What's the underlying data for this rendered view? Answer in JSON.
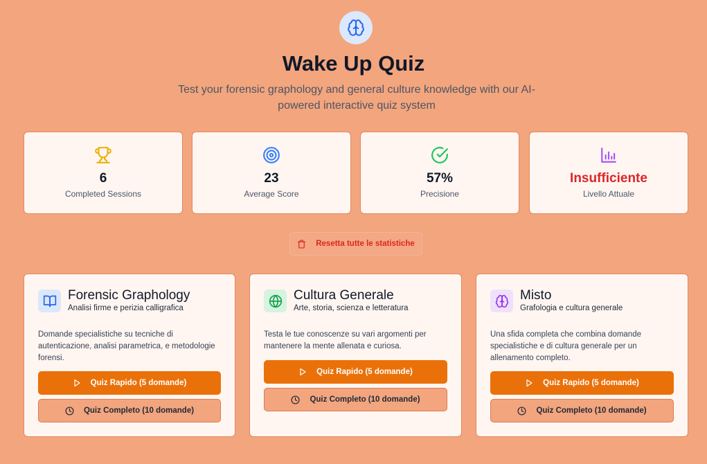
{
  "header": {
    "title": "Wake Up Quiz",
    "subtitle": "Test your forensic graphology and general culture knowledge with our AI-powered interactive quiz system",
    "logo_icon": "brain-icon"
  },
  "stats": [
    {
      "icon": "trophy-icon",
      "value": "6",
      "label": "Completed Sessions",
      "color": "#eab308"
    },
    {
      "icon": "target-icon",
      "value": "23",
      "label": "Average Score",
      "color": "#3b82f6"
    },
    {
      "icon": "check-circle-icon",
      "value": "57%",
      "label": "Precisione",
      "color": "#22c55e"
    },
    {
      "icon": "bar-chart-icon",
      "value": "Insufficiente",
      "label": "Livello Attuale",
      "color": "#a855f7"
    }
  ],
  "reset_label": "Resetta tutte le statistiche",
  "cards": [
    {
      "title": "Forensic Graphology",
      "subtitle": "Analisi firme e perizia calligrafica",
      "description": "Domande specialistiche su tecniche di autenticazione, analisi parametrica, e metodologie forensi.",
      "icon": "book-icon",
      "quick_label": "Quiz Rapido (5 domande)",
      "full_label": "Quiz Completo (10 domande)"
    },
    {
      "title": "Cultura Generale",
      "subtitle": "Arte, storia, scienza e letteratura",
      "description": "Testa le tue conoscenze su vari argomenti per mantenere la mente allenata e curiosa.",
      "icon": "globe-icon",
      "quick_label": "Quiz Rapido (5 domande)",
      "full_label": "Quiz Completo (10 domande)"
    },
    {
      "title": "Misto",
      "subtitle": "Grafologia e cultura generale",
      "description": "Una sfida completa che combina domande specialistiche e di cultura generale per un allenamento completo.",
      "icon": "brain-icon",
      "quick_label": "Quiz Rapido (5 domande)",
      "full_label": "Quiz Completo (10 domande)"
    }
  ],
  "colors": {
    "background": "#f3a57e",
    "accent": "#ea7109",
    "danger": "#dc2626",
    "card": "#fff6f2"
  }
}
